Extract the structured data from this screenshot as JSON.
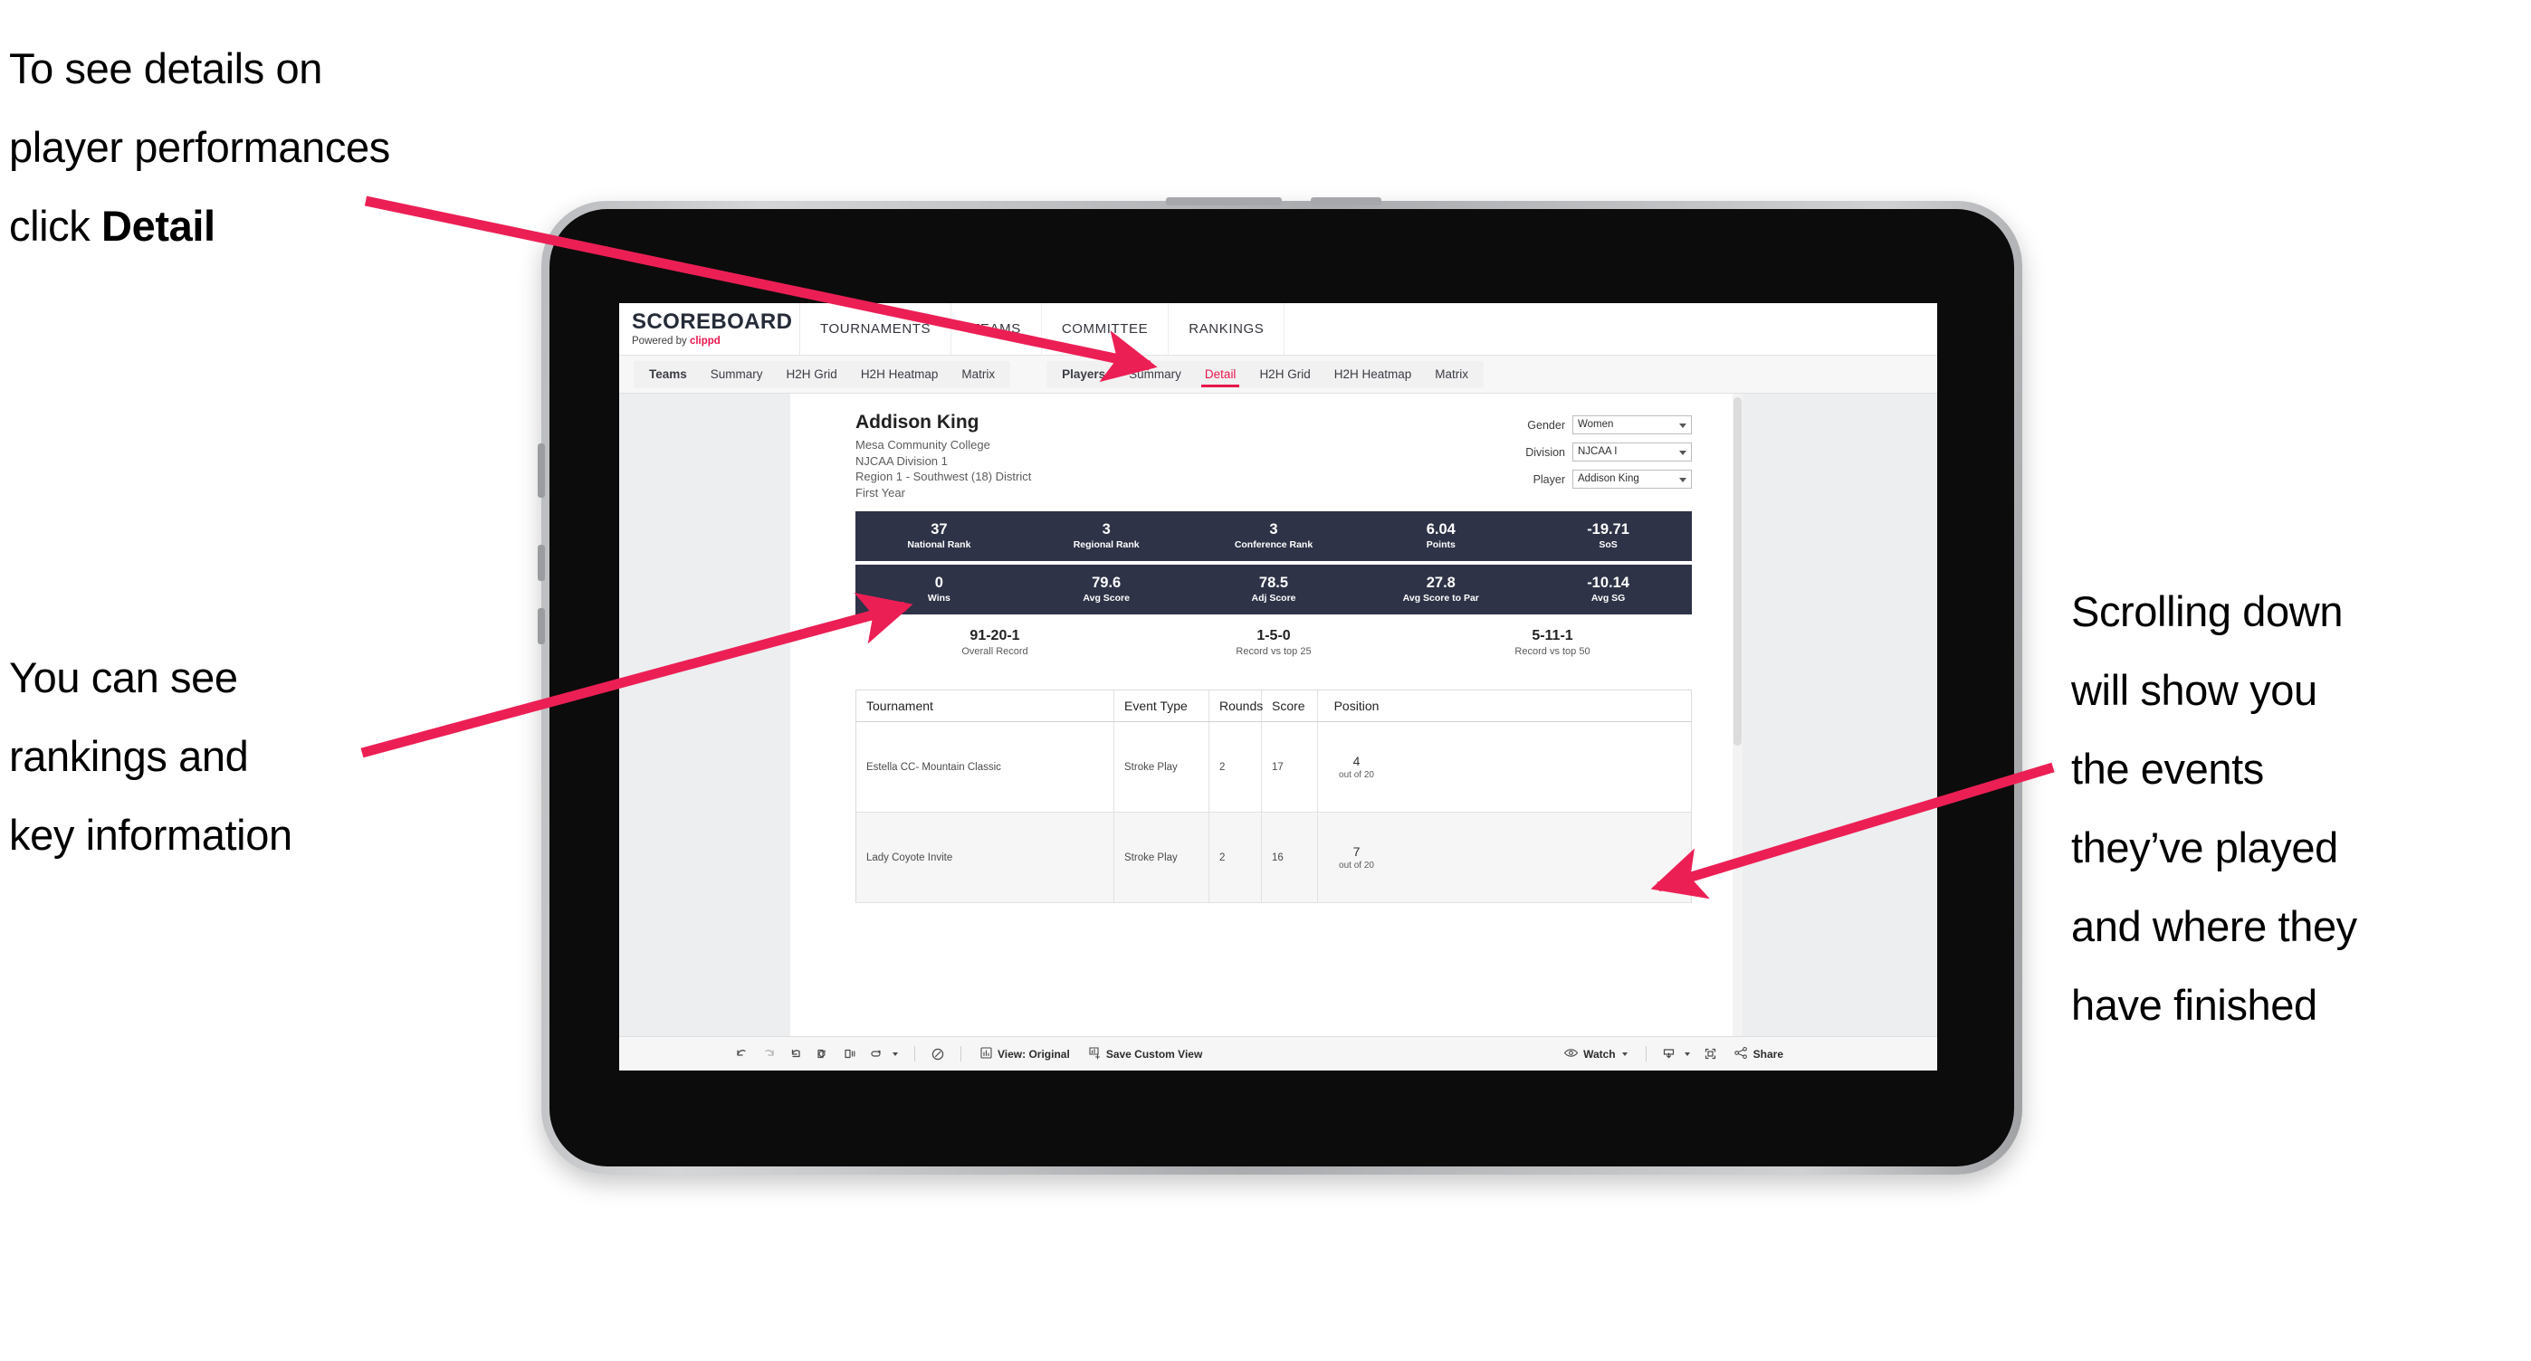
{
  "annotations": {
    "top_left_line1": "To see details on",
    "top_left_line2": "player performances",
    "top_left_line3_prefix": "click ",
    "top_left_line3_bold": "Detail",
    "left_line1": "You can see",
    "left_line2": "rankings and",
    "left_line3": "key information",
    "right_line1": "Scrolling down",
    "right_line2": "will show you",
    "right_line3": "the events",
    "right_line4": "they’ve played",
    "right_line5": "and where they",
    "right_line6": "have finished",
    "arrow_color": "#ec1f55"
  },
  "app": {
    "logo_title": "SCOREBOARD",
    "logo_sub_prefix": "Powered by ",
    "logo_sub_brand": "clippd",
    "main_nav": [
      "TOURNAMENTS",
      "TEAMS",
      "COMMITTEE",
      "RANKINGS"
    ],
    "tab_group_teams": {
      "head": "Teams",
      "items": [
        "Summary",
        "H2H Grid",
        "H2H Heatmap",
        "Matrix"
      ]
    },
    "tab_group_players": {
      "head": "Players",
      "items": [
        "Summary",
        "Detail",
        "H2H Grid",
        "H2H Heatmap",
        "Matrix"
      ],
      "active": "Detail",
      "active_color": "#e8174c"
    }
  },
  "player": {
    "name": "Addison King",
    "school": "Mesa Community College",
    "division": "NJCAA Division 1",
    "region": "Region 1 - Southwest (18) District",
    "year": "First Year"
  },
  "filters": [
    {
      "label": "Gender",
      "value": "Women"
    },
    {
      "label": "Division",
      "value": "NJCAA I"
    },
    {
      "label": "Player",
      "value": "Addison King"
    }
  ],
  "stats_row_1": [
    {
      "value": "37",
      "label": "National Rank"
    },
    {
      "value": "3",
      "label": "Regional Rank"
    },
    {
      "value": "3",
      "label": "Conference Rank"
    },
    {
      "value": "6.04",
      "label": "Points"
    },
    {
      "value": "-19.71",
      "label": "SoS"
    }
  ],
  "stats_row_2": [
    {
      "value": "0",
      "label": "Wins"
    },
    {
      "value": "79.6",
      "label": "Avg Score"
    },
    {
      "value": "78.5",
      "label": "Adj Score"
    },
    {
      "value": "27.8",
      "label": "Avg Score to Par"
    },
    {
      "value": "-10.14",
      "label": "Avg SG"
    }
  ],
  "records": [
    {
      "value": "91-20-1",
      "label": "Overall Record"
    },
    {
      "value": "1-5-0",
      "label": "Record vs top 25"
    },
    {
      "value": "5-11-1",
      "label": "Record vs top 50"
    }
  ],
  "table": {
    "headers": [
      "Tournament",
      "Event Type",
      "Rounds",
      "Score",
      "Position"
    ],
    "rows": [
      {
        "tournament": "Estella CC- Mountain Classic",
        "event_type": "Stroke Play",
        "rounds": "2",
        "score": "17",
        "position_num": "4",
        "position_sub": "out of 20"
      },
      {
        "tournament": "Lady Coyote Invite",
        "event_type": "Stroke Play",
        "rounds": "2",
        "score": "16",
        "position_num": "7",
        "position_sub": "out of 20"
      }
    ]
  },
  "toolbar": {
    "view_label": "View: Original",
    "save_label": "Save Custom View",
    "watch_label": "Watch",
    "share_label": "Share"
  },
  "colors": {
    "stat_bar_bg": "#2e3347",
    "accent": "#e8174c",
    "viz_bg": "#eceef0"
  }
}
